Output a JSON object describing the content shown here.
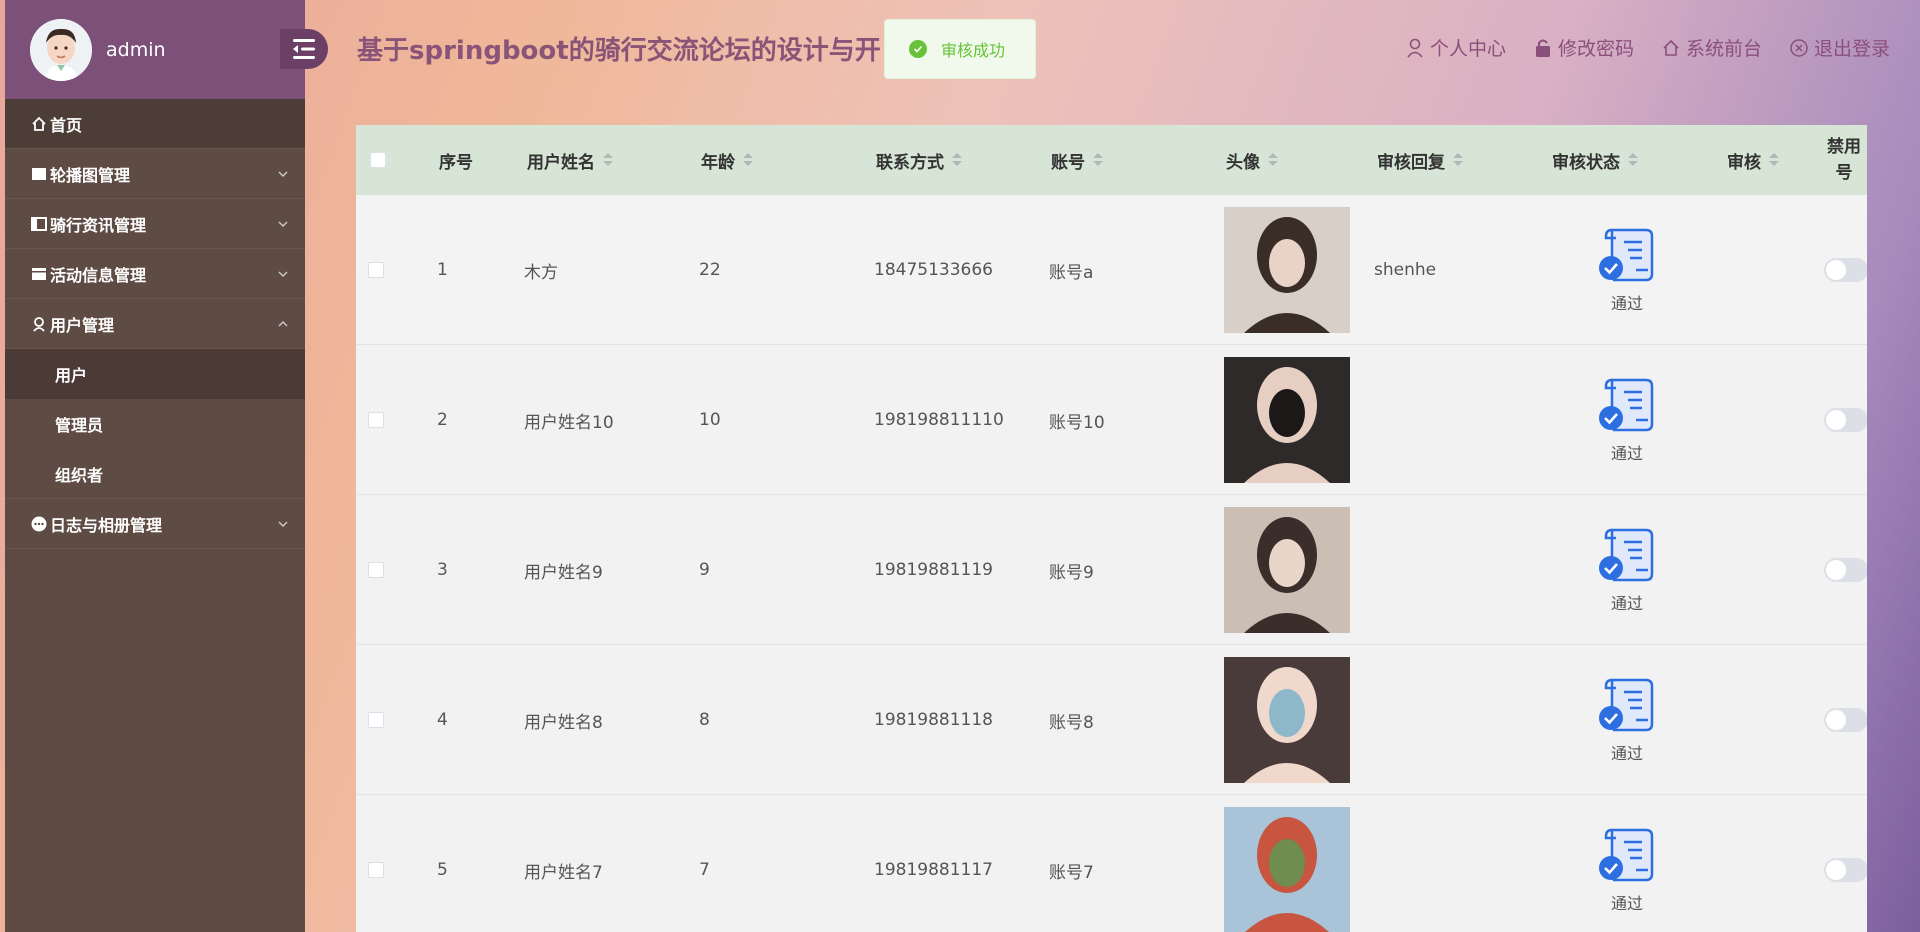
{
  "sidebar": {
    "admin_name": "admin",
    "menu": [
      {
        "label": "首页",
        "icon": "home-icon"
      },
      {
        "label": "轮播图管理",
        "icon": "image-icon"
      },
      {
        "label": "骑行资讯管理",
        "icon": "news-icon"
      },
      {
        "label": "活动信息管理",
        "icon": "calendar-icon"
      },
      {
        "label": "用户管理",
        "icon": "user-icon"
      },
      {
        "label": "日志与相册管理",
        "icon": "more-icon"
      }
    ],
    "sub_items": [
      "用户",
      "管理员",
      "组织者"
    ]
  },
  "header": {
    "title": "基于springboot的骑行交流论坛的设计与开",
    "links": [
      {
        "label": "个人中心",
        "icon": "person-icon"
      },
      {
        "label": "修改密码",
        "icon": "lock-icon"
      },
      {
        "label": "系统前台",
        "icon": "home-icon"
      },
      {
        "label": "退出登录",
        "icon": "close-circle-icon"
      }
    ]
  },
  "toast": {
    "message": "审核成功"
  },
  "table": {
    "columns": [
      "序号",
      "用户姓名",
      "年龄",
      "联系方式",
      "账号",
      "头像",
      "审核回复",
      "审核状态",
      "审核",
      "禁用",
      "号"
    ],
    "rows": [
      {
        "index": "1",
        "name": "木方",
        "age": "22",
        "phone": "18475133666",
        "account": "账号a",
        "reply": "shenhe",
        "status": "通过"
      },
      {
        "index": "2",
        "name": "用户姓名10",
        "age": "10",
        "phone": "198198811110",
        "account": "账号10",
        "reply": "",
        "status": "通过"
      },
      {
        "index": "3",
        "name": "用户姓名9",
        "age": "9",
        "phone": "19819881119",
        "account": "账号9",
        "reply": "",
        "status": "通过"
      },
      {
        "index": "4",
        "name": "用户姓名8",
        "age": "8",
        "phone": "19819881118",
        "account": "账号8",
        "reply": "",
        "status": "通过"
      },
      {
        "index": "5",
        "name": "用户姓名7",
        "age": "7",
        "phone": "19819881117",
        "account": "账号7",
        "reply": "",
        "status": "通过"
      }
    ]
  },
  "colors": {
    "sidebar_bg": "#5e4b44",
    "sidebar_head": "#7c5078",
    "header_text": "#8a4f7a",
    "table_head": "#d6e5d6",
    "success": "#67c23a",
    "status_icon": "#2d6fe0"
  }
}
